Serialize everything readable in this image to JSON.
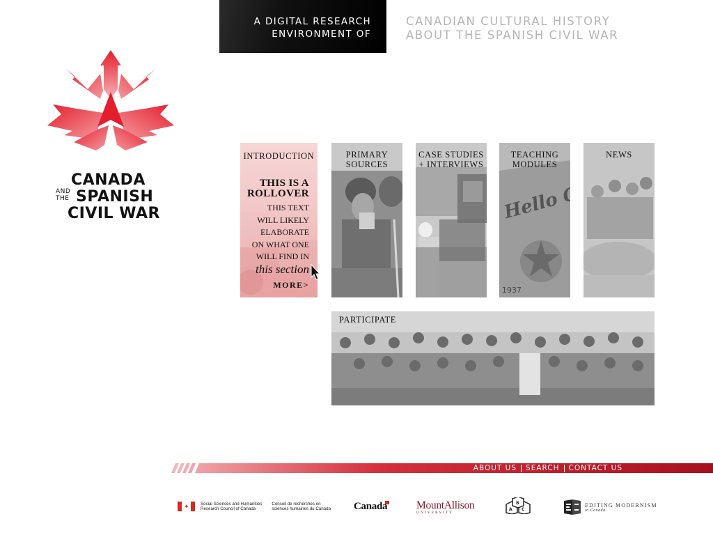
{
  "header": {
    "tagline_line1": "A DIGITAL RESEARCH",
    "tagline_line2": "ENVIRONMENT OF",
    "subtitle_line1": "CANADIAN CULTURAL HISTORY",
    "subtitle_line2": "ABOUT THE SPANISH CIVIL WAR"
  },
  "logo": {
    "line1": "CANADA",
    "and": "AND",
    "the": "THE",
    "line2": "SPANISH",
    "line3": "CIVIL WAR",
    "accent_color": "#e0202e"
  },
  "tiles": {
    "introduction": {
      "label": "INTRODUCTION",
      "rollover_head1": "THIS IS A",
      "rollover_head2": "ROLLOVER",
      "rollover_body": [
        "THIS TEXT",
        "WILL LIKELY",
        "ELABORATE",
        "ON WHAT ONE",
        "WILL FIND IN"
      ],
      "rollover_italic": "this section",
      "more": "MORE>"
    },
    "primary": {
      "label": "PRIMARY\nSOURCES"
    },
    "case": {
      "label": "CASE STUDIES\n+ INTERVIEWS"
    },
    "teaching": {
      "label": "TEACHING\nMODULES"
    },
    "news": {
      "label": "NEWS"
    },
    "participate": {
      "label": "PARTICIPATE"
    }
  },
  "footer": {
    "nav": [
      "ABOUT US",
      "SEARCH",
      "CONTACT US"
    ],
    "bar_color": "#a8101e"
  },
  "sponsors": {
    "sshrc_en_1": "Social Sciences and Humanities",
    "sshrc_en_2": "Research Council of Canada",
    "sshrc_fr_1": "Conseil de recherches en",
    "sshrc_fr_2": "sciences humaines du Canada",
    "canada": "Canada",
    "mta_name": "MountAllison",
    "mta_uni": "UNIVERSITY",
    "emc_1": "EDITING MODERNISM",
    "emc_2": "in Canada"
  }
}
